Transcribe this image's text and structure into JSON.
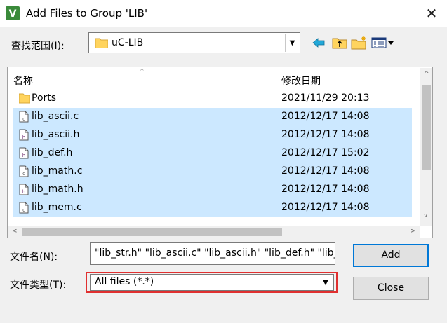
{
  "window": {
    "title": "Add Files to Group 'LIB'",
    "close_glyph": "✕",
    "app_icon_glyph": "V"
  },
  "lookin": {
    "label": "查找范围(I):",
    "value": "uC-LIB",
    "dropdown_glyph": "▼"
  },
  "toolbar": {
    "back_icon": "back-arrow-icon",
    "up_icon": "up-folder-icon",
    "new_folder_icon": "new-folder-icon",
    "view_menu_icon": "view-menu-icon"
  },
  "list": {
    "columns": {
      "name": "名称",
      "date": "修改日期"
    },
    "sort_glyph": "^",
    "rows": [
      {
        "name": "Ports",
        "date": "2021/11/29 20:13",
        "type": "folder",
        "selected": false
      },
      {
        "name": "lib_ascii.c",
        "date": "2012/12/17 14:08",
        "type": "c-file",
        "selected": true
      },
      {
        "name": "lib_ascii.h",
        "date": "2012/12/17 14:08",
        "type": "h-file",
        "selected": true
      },
      {
        "name": "lib_def.h",
        "date": "2012/12/17 15:02",
        "type": "h-file",
        "selected": true
      },
      {
        "name": "lib_math.c",
        "date": "2012/12/17 14:08",
        "type": "c-file",
        "selected": true
      },
      {
        "name": "lib_math.h",
        "date": "2012/12/17 14:08",
        "type": "h-file",
        "selected": true
      },
      {
        "name": "lib_mem.c",
        "date": "2012/12/17 14:08",
        "type": "c-file",
        "selected": true
      }
    ]
  },
  "scroll": {
    "up": "^",
    "down": "v",
    "left": "<",
    "right": ">"
  },
  "filename": {
    "label": "文件名(N):",
    "value": "\"lib_str.h\" \"lib_ascii.c\" \"lib_ascii.h\" \"lib_def.h\" \"lib_m"
  },
  "filetype": {
    "label": "文件类型(T):",
    "value": "All files (*.*)",
    "dropdown_glyph": "▼"
  },
  "buttons": {
    "add": "Add",
    "close": "Close"
  },
  "colors": {
    "selection": "#cce8ff",
    "highlight_border": "#e03030",
    "default_button_border": "#0078d7",
    "folder": "#ffd45e"
  }
}
